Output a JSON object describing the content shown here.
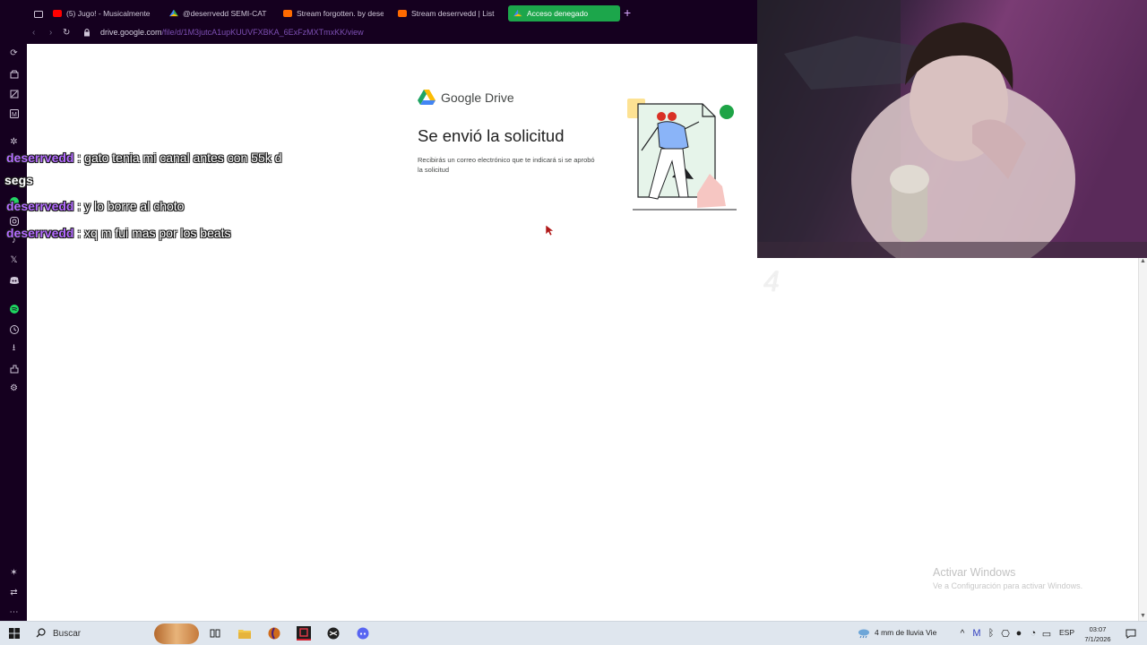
{
  "browser": {
    "tabs": [
      {
        "label": "(5) Jugo! - Musicalmente",
        "favicon": "youtube-icon"
      },
      {
        "label": "@deserrvedd SEMI-CAT",
        "favicon": "drive-icon"
      },
      {
        "label": "Stream forgotten. by dese",
        "favicon": "soundcloud-icon"
      },
      {
        "label": "Stream deserrvedd | List",
        "favicon": "soundcloud-icon"
      },
      {
        "label": "Acceso denegado",
        "favicon": "drive-icon",
        "active": true
      }
    ],
    "new_tab": "+",
    "url_host": "drive.google.com",
    "url_path": "/file/d/1M3jutcA1upKUUVFXBKA_6ExFzMXTmxKK/view",
    "accent": "#1ca64b"
  },
  "page": {
    "brand": "Google Drive",
    "title": "Se envió la solicitud",
    "description": "Recibirás un correo electrónico que te indicará si se aprobó la solicitud"
  },
  "chat": {
    "messages": [
      {
        "user": "deserrvedd",
        "sep": " : ",
        "text": "gato tenia mi canal antes con 55k d"
      },
      {
        "user": "deserrvedd",
        "sep": " : ",
        "text": "y lo borre al choto"
      },
      {
        "user": "deserrvedd",
        "sep": " : ",
        "text": "xq m fui mas por los beats"
      }
    ],
    "continuation": "segs",
    "user_color": "#b46cff"
  },
  "overlay": {
    "ghost_number": "4"
  },
  "windows": {
    "activate_title": "Activar Windows",
    "activate_sub": "Ve a Configuración para activar Windows."
  },
  "taskbar": {
    "search_label": "Buscar",
    "weather": "4 mm de lluvia Vie",
    "lang": "ESP",
    "time": "03:07",
    "date": "7/1/2026"
  }
}
